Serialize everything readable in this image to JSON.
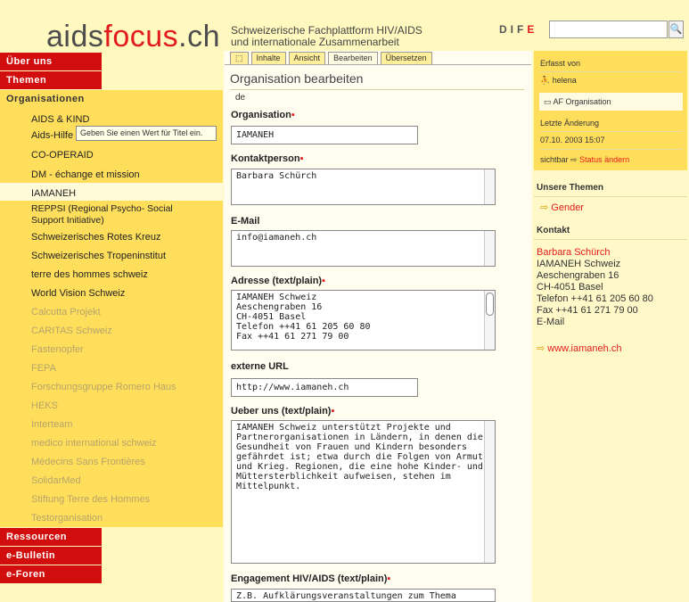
{
  "header": {
    "logo_part1": "aids",
    "logo_part2": "focus",
    "logo_part3": ".ch",
    "tagline_line1": "Schweizerische Fachplattform HIV/AIDS",
    "tagline_line2": "und internationale Zusammenarbeit",
    "lang_d": "D",
    "lang_i": "I",
    "lang_f": "F",
    "lang_e": "E",
    "search_placeholder": "",
    "search_button": "🔍"
  },
  "nav": {
    "top_items": [
      "Über uns",
      "Themen"
    ],
    "section": "Organisationen",
    "bottom_items": [
      "Ressourcen",
      "e-Bulletin",
      "e-Foren"
    ],
    "orgs": [
      {
        "label": "AIDS & KIND",
        "muted": false
      },
      {
        "label": "Aids-Hilfe",
        "muted": false
      },
      {
        "label": "CO-OPERAID",
        "muted": false
      },
      {
        "label": "DM - échange et mission",
        "muted": false
      },
      {
        "label": "IAMANEH",
        "muted": false
      },
      {
        "label": "REPPSI (Regional Psycho- Social Support Initiative)",
        "muted": false
      },
      {
        "label": "Schweizerisches Rotes Kreuz",
        "muted": false
      },
      {
        "label": "Schweizerisches Tropeninstitut",
        "muted": false
      },
      {
        "label": "terre des hommes schweiz",
        "muted": false
      },
      {
        "label": "World Vision Schweiz",
        "muted": false
      },
      {
        "label": "Calcutta Projekt",
        "muted": true
      },
      {
        "label": "CARITAS Schweiz",
        "muted": true
      },
      {
        "label": "Fastenopfer",
        "muted": true
      },
      {
        "label": "FEPA",
        "muted": true
      },
      {
        "label": "Forschungsgruppe Romero Haus",
        "muted": true
      },
      {
        "label": "HEKS",
        "muted": true
      },
      {
        "label": "Interteam",
        "muted": true
      },
      {
        "label": "medico international schweiz",
        "muted": true
      },
      {
        "label": "Médecins Sans Frontières",
        "muted": true
      },
      {
        "label": "SolidarMed",
        "muted": true
      },
      {
        "label": "Stiftung Terre des Hommes",
        "muted": true
      },
      {
        "label": "Testorganisation",
        "muted": true
      }
    ],
    "tooltip": "Geben Sie einen Wert für Titel ein."
  },
  "tabs": [
    "⬚",
    "Inhalte",
    "Ansicht",
    "Bearbeiten",
    "Übersetzen"
  ],
  "form": {
    "heading": "Organisation bearbeiten",
    "lang": "de",
    "organisation_label": "Organisation",
    "organisation_value": "IAMANEH",
    "contact_label": "Kontaktperson",
    "contact_value": "Barbara Schürch",
    "email_label": "E-Mail",
    "email_value": "info@iamaneh.ch",
    "address_label": "Adresse (text/plain)",
    "address_value": "IAMANEH Schweiz\nAeschengraben 16\nCH-4051 Basel\nTelefon ++41 61 205 60 80\nFax ++41 61 271 79 00",
    "url_label": "externe URL",
    "url_value": "http://www.iamaneh.ch",
    "about_label": "Ueber uns (text/plain)",
    "about_value": "IAMANEH Schweiz unterstützt Projekte und Partnerorganisationen in Ländern, in denen die Gesundheit von Frauen und Kindern besonders gefährdet ist; etwa durch die Folgen von Armut und Krieg. Regionen, die eine hohe Kinder- und Müttersterblichkeit aufweisen, stehen im Mittelpunkt.",
    "engagement_label": "Engagement HIV/AIDS (text/plain)",
    "engagement_value": "Z.B. Aufklärungsveranstaltungen zum Thema"
  },
  "sidebar_right": {
    "created_by_label": "Erfasst von",
    "created_by_user": "helena",
    "folder_label": "AF Organisation",
    "last_change_label": "Letzte Änderung",
    "last_change_value": "07.10. 2003 15:07",
    "visibility_label": "sichtbar",
    "status_link": "Status ändern",
    "themes_heading": "Unsere Themen",
    "theme_link": "Gender",
    "contact_heading": "Kontakt",
    "contact_name": "Barbara Schürch",
    "contact_lines": [
      "IAMANEH Schweiz",
      "Aeschengraben 16",
      "CH-4051 Basel",
      "Telefon ++41 61 205 60 80",
      "Fax ++41 61 271 79 00",
      "E-Mail"
    ],
    "website_link": "www.iamaneh.ch"
  },
  "colors": {
    "brand_red": "#d10d0d",
    "nav_yellow": "#ffde5c",
    "page_bg": "#fff8bf"
  }
}
